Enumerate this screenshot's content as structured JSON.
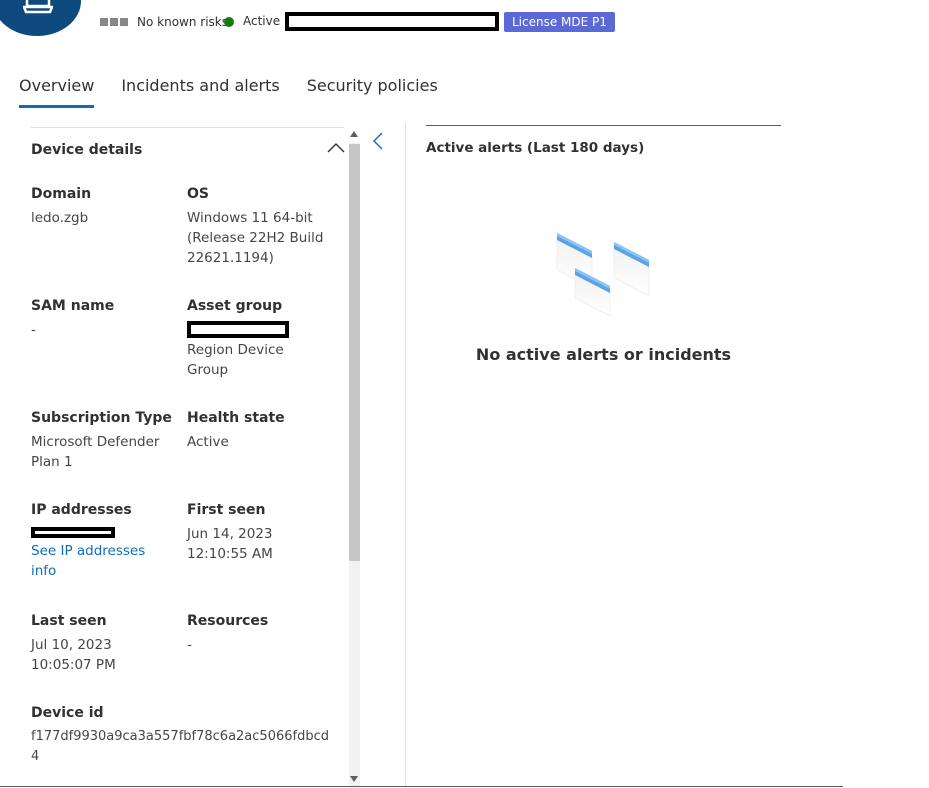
{
  "header": {
    "risk_label": "No known risks",
    "status_label": "Active",
    "license_label": "License MDE P1",
    "colors": {
      "avatar": "#0f4a7e",
      "active_dot": "#107c10",
      "license": "#5b69d7",
      "accent": "#0f6cbd"
    },
    "icons": {
      "avatar": "laptop-icon"
    }
  },
  "tabs": [
    {
      "label": "Overview",
      "active": true
    },
    {
      "label": "Incidents and alerts",
      "active": false
    },
    {
      "label": "Security policies",
      "active": false
    }
  ],
  "device_details": {
    "title": "Device details",
    "domain": {
      "label": "Domain",
      "value": "ledo.zgb"
    },
    "os": {
      "label": "OS",
      "value_lines": [
        "Windows 11 64-bit",
        "(Release 22H2 Build",
        "22621.1194)"
      ]
    },
    "sam_name": {
      "label": "SAM name",
      "value": "-"
    },
    "asset_group": {
      "label": "Asset group",
      "value_lines": [
        "Region Device",
        "Group"
      ]
    },
    "subscription_type": {
      "label": "Subscription Type",
      "value_lines": [
        "Microsoft Defender",
        "Plan 1"
      ]
    },
    "health_state": {
      "label": "Health state",
      "value": "Active"
    },
    "ip_addresses": {
      "label": "IP addresses",
      "link_lines": [
        "See IP addresses",
        "info"
      ]
    },
    "first_seen": {
      "label": "First seen",
      "value_lines": [
        "Jun 14, 2023",
        "12:10:55 AM"
      ]
    },
    "last_seen": {
      "label": "Last seen",
      "value_lines": [
        "Jul 10, 2023",
        "10:05:07 PM"
      ]
    },
    "resources": {
      "label": "Resources",
      "value": "-"
    },
    "device_id": {
      "label": "Device id",
      "value_lines": [
        "f177df9930a9ca3a557fbf78c6a2ac5066fdbcd",
        "4"
      ]
    }
  },
  "alerts_panel": {
    "title": "Active alerts (Last 180 days)",
    "empty_message": "No active alerts or incidents"
  }
}
